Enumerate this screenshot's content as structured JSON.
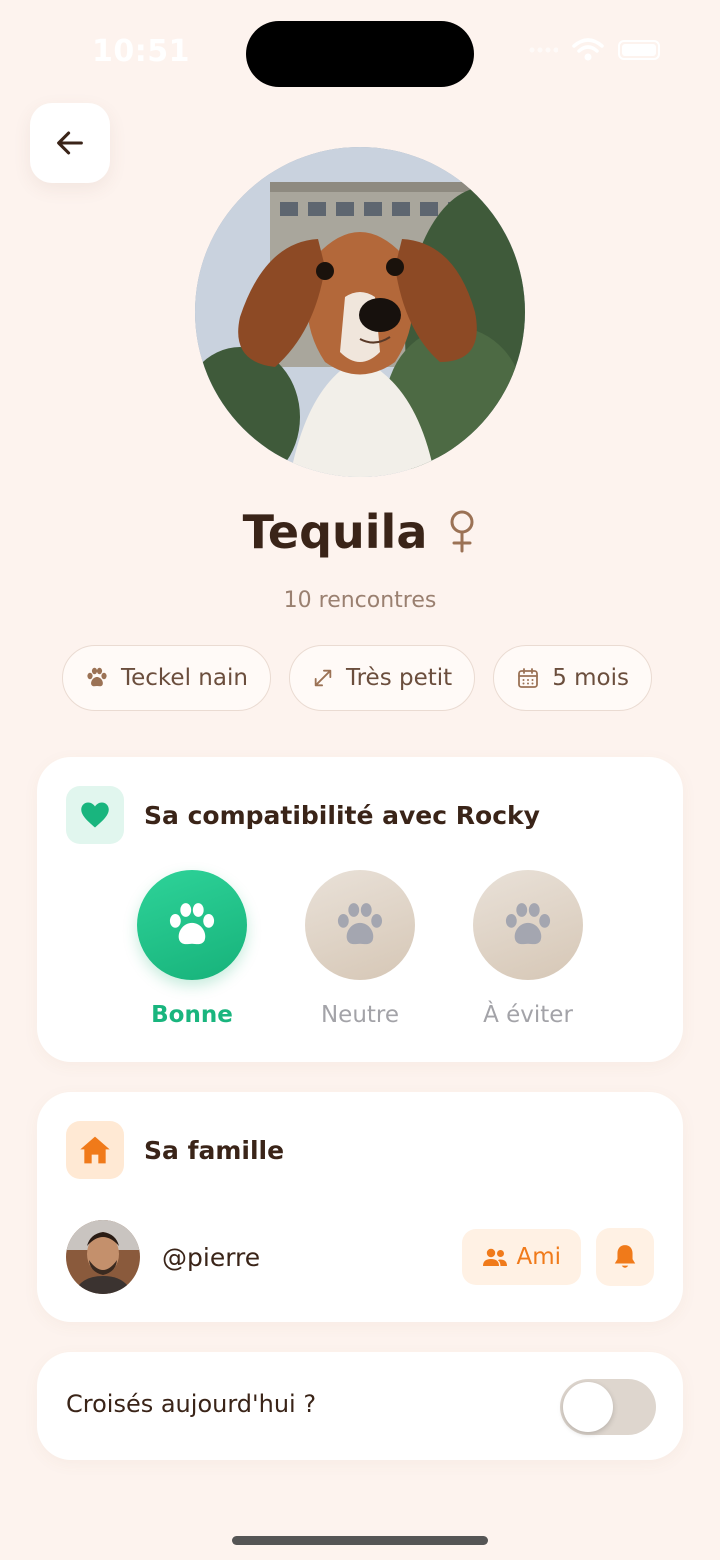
{
  "status_bar": {
    "time": "10:51"
  },
  "profile": {
    "name": "Tequila",
    "gender_symbol": "♀",
    "meetings": "10 rencontres",
    "chips": [
      {
        "icon": "paw-icon",
        "label": "Teckel nain"
      },
      {
        "icon": "resize-arrows-icon",
        "label": "Très petit"
      },
      {
        "icon": "calendar-icon",
        "label": "5 mois"
      }
    ]
  },
  "compatibility": {
    "title": "Sa compatibilité avec Rocky",
    "options": [
      {
        "label": "Bonne",
        "selected": true
      },
      {
        "label": "Neutre",
        "selected": false
      },
      {
        "label": "À éviter",
        "selected": false
      }
    ]
  },
  "family": {
    "title": "Sa famille",
    "members": [
      {
        "username": "@pierre",
        "friend_label": "Ami"
      }
    ]
  },
  "crossed_today": {
    "label": "Croisés aujourd'hui ?",
    "enabled": false
  },
  "colors": {
    "background": "#fdf3ee",
    "accent_green": "#19b57e",
    "accent_orange": "#f07a1a",
    "text_dark": "#3a2418"
  }
}
